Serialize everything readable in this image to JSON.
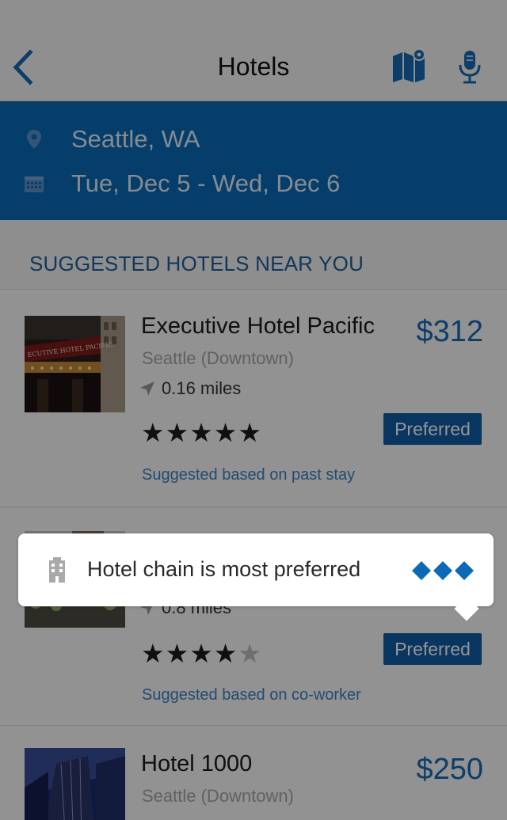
{
  "header": {
    "title": "Hotels",
    "back_icon": "chevron-left-icon",
    "map_icon": "map-icon",
    "mic_icon": "microphone-icon"
  },
  "search": {
    "location": "Seattle, WA",
    "location_icon": "location-pin-icon",
    "dates": "Tue, Dec 5 - Wed,  Dec 6",
    "dates_icon": "calendar-icon"
  },
  "section": {
    "title": "SUGGESTED HOTELS NEAR YOU"
  },
  "hotels": [
    {
      "name": "Executive Hotel Pacific",
      "price": "$312",
      "area": "Seattle (Downtown)",
      "distance": "0.16 miles",
      "rating": 5,
      "badge": "Preferred",
      "suggestion": "Suggested based on past stay",
      "sign_text": "ECUTIVE HOTEL PACIFIC"
    },
    {
      "name": "",
      "price": "",
      "area": "",
      "distance": "0.8 miles",
      "rating": 4,
      "badge": "Preferred",
      "suggestion": "Suggested based on co-worker"
    },
    {
      "name": "Hotel 1000",
      "price": "$250",
      "area": "Seattle (Downtown)"
    }
  ],
  "tooltip": {
    "message": "Hotel chain is most preferred",
    "icon": "building-icon",
    "preference_level": 3
  },
  "colors": {
    "accent": "#0a6ab8",
    "badge": "#0e5ea8",
    "link": "#3f82c4",
    "price": "#1769b5"
  }
}
